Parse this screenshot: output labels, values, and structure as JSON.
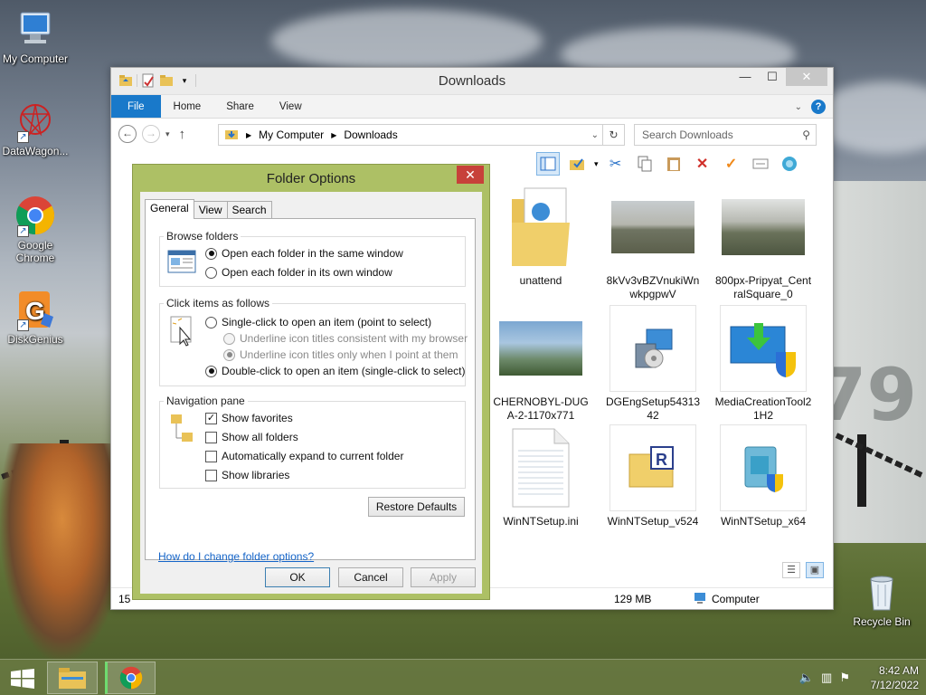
{
  "desktop": {
    "icons": [
      {
        "label": "My Computer",
        "icon": "computer-icon"
      },
      {
        "label": "DataWagon...",
        "icon": "datawagon-icon"
      },
      {
        "label": "Google Chrome",
        "icon": "chrome-icon"
      },
      {
        "label": "DiskGenius",
        "icon": "diskgenius-icon"
      },
      {
        "label": "Recycle Bin",
        "icon": "recycle-bin-icon"
      }
    ]
  },
  "explorer": {
    "title": "Downloads",
    "ribbon_tabs": [
      "File",
      "Home",
      "Share",
      "View"
    ],
    "breadcrumb": [
      "My Computer",
      "Downloads"
    ],
    "search_placeholder": "Search Downloads",
    "files": [
      {
        "name": "unattend",
        "type": "folder-doc"
      },
      {
        "name": "8kVv3vBZVnukiWnwkpgpwV",
        "type": "photo"
      },
      {
        "name": "800px-Pripyat_CentralSquare_0",
        "type": "photo"
      },
      {
        "name": "CHERNOBYL-DUGA-2-1170x771",
        "type": "photo"
      },
      {
        "name": "DGEngSetup5431342",
        "type": "installer"
      },
      {
        "name": "MediaCreationTool21H2",
        "type": "installer"
      },
      {
        "name": "WinNTSetup.ini",
        "type": "ini"
      },
      {
        "name": "WinNTSetup_v524",
        "type": "archive"
      },
      {
        "name": "WinNTSetup_x64",
        "type": "installer"
      }
    ],
    "status": {
      "count_partial": "15",
      "size": "129 MB",
      "location": "Computer"
    }
  },
  "dialog": {
    "title": "Folder Options",
    "tabs": [
      "General",
      "View",
      "Search"
    ],
    "browse": {
      "title": "Browse folders",
      "opt1": "Open each folder in the same window",
      "opt2": "Open each folder in its own window",
      "selected": 1
    },
    "click": {
      "title": "Click items as follows",
      "opt1": "Single-click to open an item (point to select)",
      "sub1": "Underline icon titles consistent with my browser",
      "sub2": "Underline icon titles only when I point at them",
      "opt2": "Double-click to open an item (single-click to select)",
      "selected": 2
    },
    "nav": {
      "title": "Navigation pane",
      "show_favorites": "Show favorites",
      "show_all_folders": "Show all folders",
      "auto_expand": "Automatically expand to current folder",
      "show_libraries": "Show libraries"
    },
    "restore": "Restore Defaults",
    "help_link": "How do I change folder options?",
    "ok": "OK",
    "cancel": "Cancel",
    "apply": "Apply"
  },
  "taskbar": {
    "time": "8:42 AM",
    "date": "7/12/2022"
  }
}
